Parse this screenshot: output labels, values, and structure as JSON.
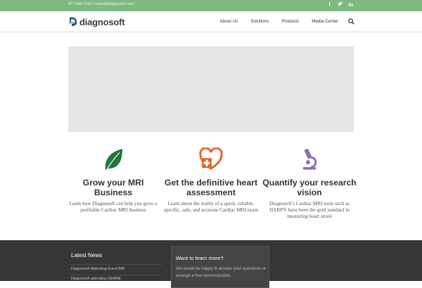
{
  "topbar": {
    "contact": "877-996-7111 | sales@diagnosoft.com",
    "social": [
      "facebook-icon",
      "twitter-icon",
      "linkedin-icon"
    ]
  },
  "header": {
    "logo_text": "diagnosoft",
    "nav": [
      "About Us",
      "Solutions",
      "Products",
      "Media Center"
    ]
  },
  "features": [
    {
      "icon": "leaf-icon",
      "color": "#1e7a3a",
      "title": "Grow your MRI Business",
      "text": "Learn how Diagnosoft can help you grow a profitable Cardiac MRI business"
    },
    {
      "icon": "heart-plus-icon",
      "color": "#e2672c",
      "title": "Get the definitive heart assessment",
      "text": "Learn about the reality of a quick, reliable, specific, safe, and accurate Cardiac MRI exam"
    },
    {
      "icon": "microscope-icon",
      "color": "#8b6fb3",
      "title": "Quantify your research vision",
      "text": "Diagnosoft's Cardiac MRI tools such as HARP® have been the gold standard in measuring heart strain"
    }
  ],
  "footer": {
    "news_title": "Latest News",
    "news": [
      "Diagnosoft Attending EuroCMR",
      "Diagnosoft attending ISMRM"
    ],
    "learn_title": "Want to learn more?",
    "learn_text": "We would be happy to answer your questions or arrange a free demonstration."
  }
}
